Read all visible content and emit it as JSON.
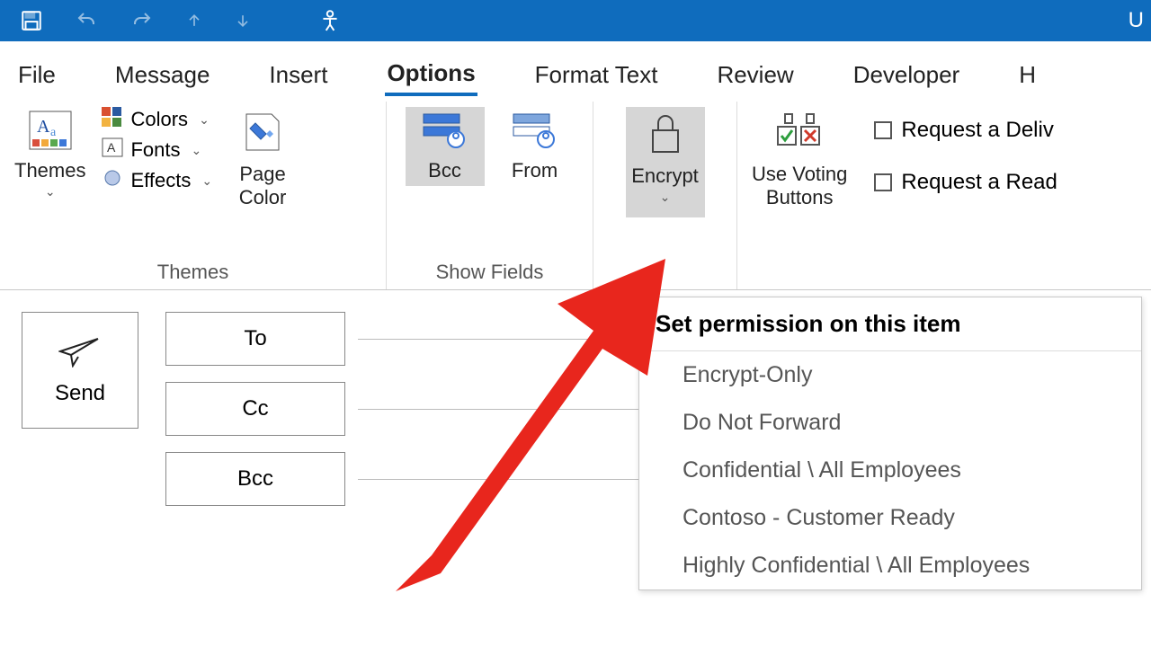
{
  "titlebar": {
    "right_text": "U"
  },
  "tabs": {
    "items": [
      {
        "label": "File"
      },
      {
        "label": "Message"
      },
      {
        "label": "Insert"
      },
      {
        "label": "Options"
      },
      {
        "label": "Format Text"
      },
      {
        "label": "Review"
      },
      {
        "label": "Developer"
      },
      {
        "label": "H"
      }
    ],
    "active_index": 3
  },
  "ribbon": {
    "themes_group": {
      "label": "Themes",
      "themes_btn": "Themes",
      "colors": "Colors",
      "fonts": "Fonts",
      "effects": "Effects",
      "page_color": "Page\nColor"
    },
    "show_fields_group": {
      "label": "Show Fields",
      "bcc": "Bcc",
      "from": "From"
    },
    "encrypt_btn": "Encrypt",
    "voting_btn": "Use Voting\nButtons",
    "request_delivery": "Request a Deliv",
    "request_read": "Request a Read"
  },
  "compose": {
    "send": "Send",
    "to": "To",
    "cc": "Cc",
    "bcc": "Bcc"
  },
  "perm_menu": {
    "header": "Set permission on this item",
    "items": [
      "Encrypt-Only",
      "Do Not Forward",
      "Confidential \\ All Employees",
      "Contoso - Customer Ready",
      "Highly Confidential \\ All Employees"
    ]
  }
}
